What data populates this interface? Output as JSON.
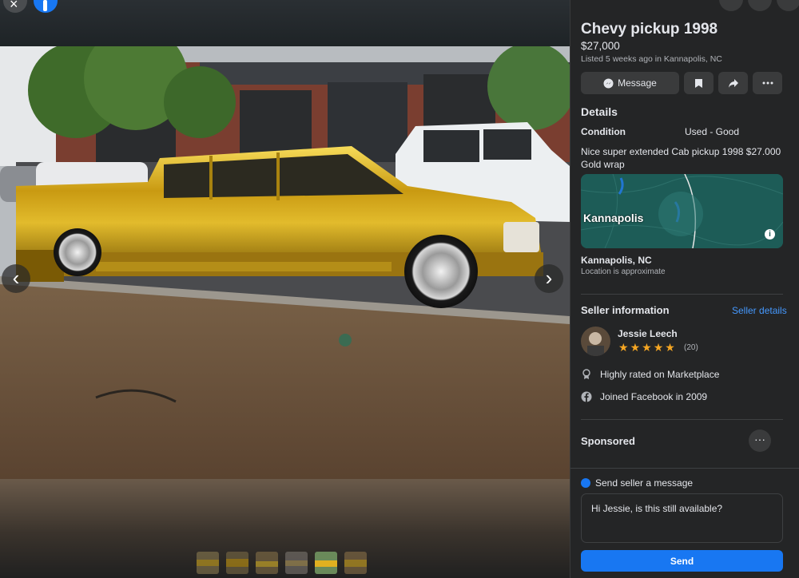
{
  "listing": {
    "title": "Chevy pickup 1998",
    "price": "$27,000",
    "listed": "Listed 5 weeks ago in Kannapolis, NC"
  },
  "actions": {
    "message_label": "Message"
  },
  "details": {
    "heading": "Details",
    "condition_label": "Condition",
    "condition_value": "Used - Good",
    "description": "Nice super extended Cab pickup 1998 $27.000 Gold wrap"
  },
  "location": {
    "map_label": "Kannapolis",
    "name": "Kannapolis, NC",
    "note": "Location is approximate"
  },
  "seller": {
    "heading": "Seller information",
    "details_link": "Seller details",
    "name": "Jessie Leech",
    "rating_count": "(20)",
    "stars": 5,
    "badge_text": "Highly rated on Marketplace",
    "joined_text": "Joined Facebook in 2009"
  },
  "sponsored": {
    "heading": "Sponsored"
  },
  "message_box": {
    "heading": "Send seller a message",
    "input_value": "Hi Jessie, is this still available?",
    "send_label": "Send"
  },
  "gallery": {
    "thumbnail_count": 6,
    "active_index": 4
  },
  "colors": {
    "accent": "#1877f2",
    "link": "#4599ff",
    "star": "#f5a623",
    "panel_bg": "#242526"
  }
}
